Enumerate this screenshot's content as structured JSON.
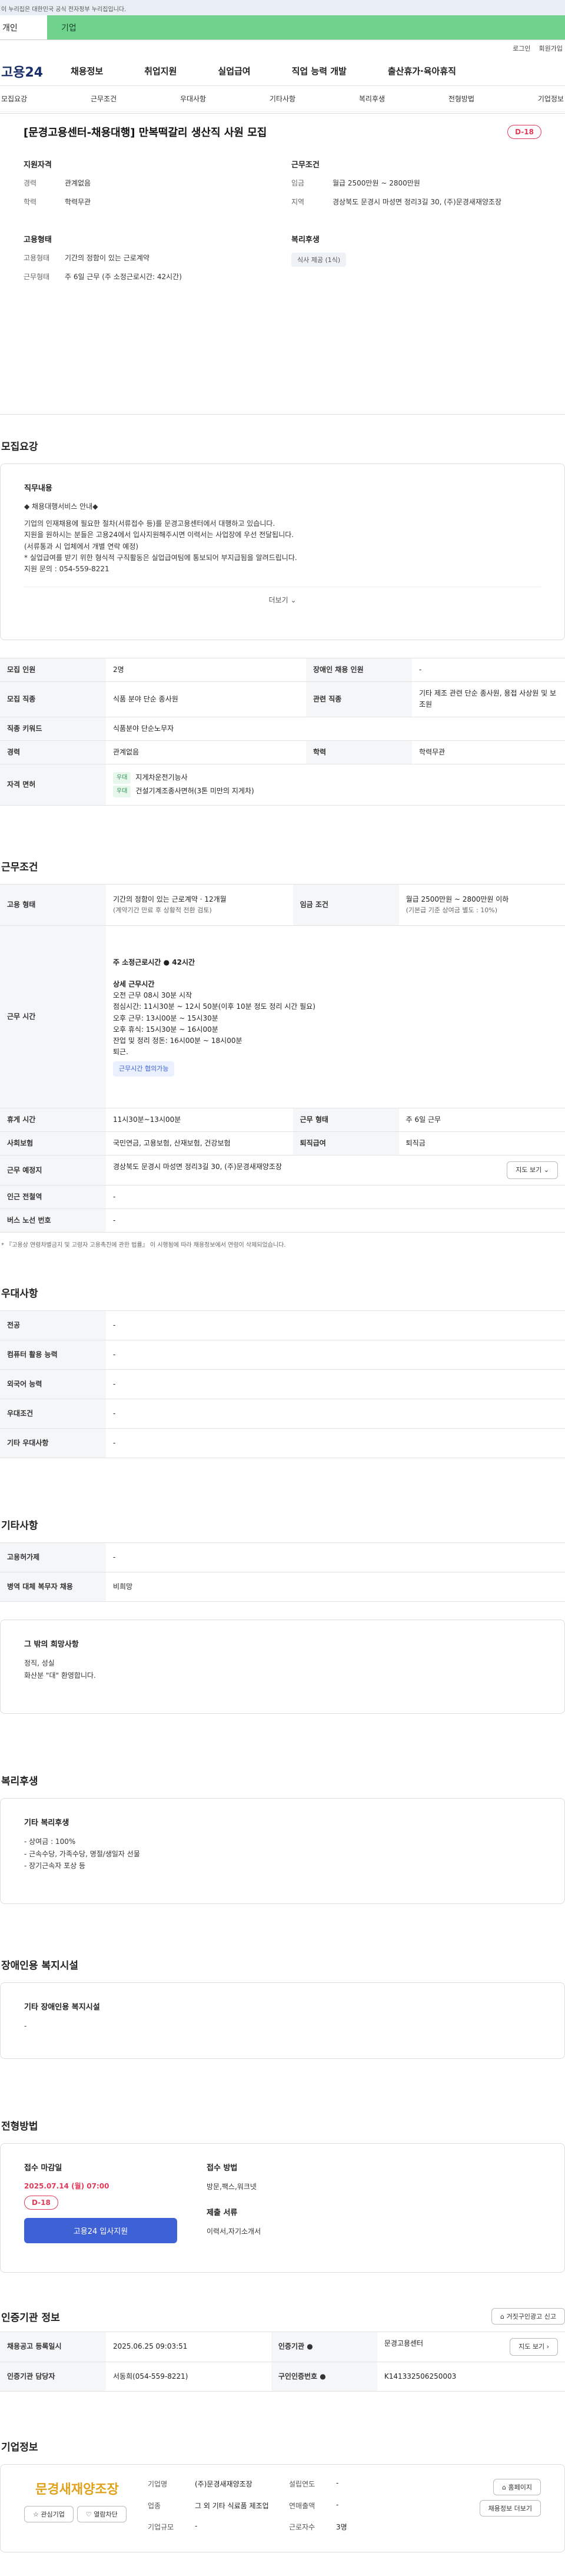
{
  "topbar": {
    "notice": "이 누리집은 대한민국 공식 전자정부 누리집입니다."
  },
  "tabs": {
    "personal": "개인",
    "company": "기업"
  },
  "util": {
    "login": "로그인",
    "join": "회원가입"
  },
  "gnb": {
    "logo": "고용24",
    "menu": [
      "채용정보",
      "취업지원",
      "실업급여",
      "직업 능력 개발",
      "출산휴가·육아휴직"
    ]
  },
  "anchors": [
    "모집요강",
    "근무조건",
    "우대사항",
    "기타사항",
    "복리후생",
    "전형방법",
    "기업정보"
  ],
  "job": {
    "title": "[문경고용센터-채용대행] 만복떡갈리 생산직 사원 모집",
    "dday": "D-18",
    "qual": {
      "h": "지원자격",
      "career_k": "경력",
      "career_v": "관계없음",
      "edu_k": "학력",
      "edu_v": "학력무관"
    },
    "cond": {
      "h": "근무조건",
      "wage_k": "임금",
      "wage_v": "월급 2500만원 ~ 2800만원",
      "region_k": "지역",
      "region_v": "경상북도 문경시 마성면 정리3길 30, (주)문경새재양조장"
    },
    "emp": {
      "h": "고용형태",
      "type_k": "고용형태",
      "type_v": "기간의 정함이 있는 근로계약",
      "time_k": "근무형태",
      "time_v": "주 6일 근무 (주 소정근로시간: 42시간)"
    },
    "welfare": {
      "h": "복리후생",
      "tag": "식사 제공 (1식)"
    }
  },
  "recruit": {
    "h": "모집요강",
    "desc_h": "직무내용",
    "desc": [
      "◆ 채용대행서비스 안내◆",
      "기업의 인재채용에 필요한 절차(서류접수 등)를 문경고용센터에서 대행하고 있습니다.",
      "지원을 원하시는 분들은 고용24에서 입사지원해주시면 이력서는 사업장에 우선 전달됩니다.",
      "(서류통과 시 업체에서 개별 연락 예정)",
      "* 실업급여를 받기 위한 형식적 구직활동은 실업급여팀에 통보되어 부지급됨을 알려드립니다.",
      "지원 문의 : 054-559-8221"
    ],
    "more": "더보기",
    "rows": {
      "count_k": "모집 인원",
      "count_v": "2명",
      "dis_k": "장애인 채용 인원",
      "dis_v": "-",
      "job_k": "모집 직종",
      "job_v": "식품 분야 단순 종사원",
      "rel_k": "관련 직종",
      "rel_v": "기타 제조 관련 단순 종사원, 용접 사상원 및 보조원",
      "kw_k": "직종 키워드",
      "kw_v": "식품분야 단순노무자",
      "career_k": "경력",
      "career_v": "관계없음",
      "edu_k": "학력",
      "edu_v": "학력무관",
      "lic_k": "자격 면허",
      "lic": [
        {
          "badge": "우대",
          "name": "지게차운전기능사"
        },
        {
          "badge": "우대",
          "name": "건설기계조종사면허(3톤 미만의 지게차)"
        }
      ]
    }
  },
  "work": {
    "h": "근무조건",
    "emp_k": "고용 형태",
    "emp_v": "기간의 정함이 있는 근로계약 · 12개월",
    "emp_sub": "(계약기간 만료 후 상황적 전환 검토)",
    "wage_k": "임금 조건",
    "wage_v": "월급 2500만원 ~ 2800만원 이하",
    "wage_sub": "(기본급 기준 상여금 별도 : 10%)",
    "time_k": "근무 시간",
    "time_lines": [
      "주 소정근로시간 ● 42시간",
      "",
      "상세 근무시간",
      "오전 근무 08시 30분 시작",
      "점심시간: 11시30분 ~ 12시 50분(이후 10분 정도 정리 시간 필요)",
      "오후 근무: 13시00분 ~ 15시30분",
      "오후 휴식: 15시30분 ~ 16시00분",
      "잔업 및 정리 정돈: 16시00분 ~ 18시00분",
      "퇴근."
    ],
    "time_tag": "근무시간 협의가능",
    "rest_k": "휴게 시간",
    "rest_v": "11시30분~13시00분",
    "form_k": "근무 형태",
    "form_v": "주 6일 근무",
    "ins_k": "사회보험",
    "ins_v": "국민연금, 고용보험, 산재보험, 건강보험",
    "ret_k": "퇴직급여",
    "ret_v": "퇴직금",
    "loc_k": "근무 예정지",
    "loc_v": "경상북도 문경시 마성면 정리3길 30, (주)문경새재양조장",
    "map": "지도 보기",
    "sub_k": "인근 전철역",
    "sub_v": "-",
    "bus_k": "버스 노선 번호",
    "bus_v": "-",
    "note": "* 『고용상 연령차별금지 및 고령자 고용촉진에 관한 법률』 이 시행됨에 따라 채용정보에서 연령이 삭제되었습니다."
  },
  "pref": {
    "h": "우대사항",
    "rows": [
      [
        "전공",
        "-"
      ],
      [
        "컴퓨터 활용 능력",
        "-"
      ],
      [
        "외국어 능력",
        "-"
      ],
      [
        "우대조건",
        "-"
      ],
      [
        "기타 우대사항",
        "-"
      ]
    ]
  },
  "etc": {
    "h": "기타사항",
    "rows": [
      [
        "고용허가제",
        "-"
      ],
      [
        "병역 대체 복무자 채용",
        "비희망"
      ]
    ],
    "box_h": "그 밖의 희망사항",
    "box": [
      "정직, 성실",
      "화산분 \"대\" 환영합니다."
    ]
  },
  "benefit": {
    "h": "복리후생",
    "box_h": "기타 복리후생",
    "box": [
      "- 상여금 : 100%",
      "- 근속수당, 가족수당, 명절/생일자 선물",
      "- 장기근속자 포상 등"
    ]
  },
  "disfac": {
    "h": "장애인용 복지시설",
    "box_h": "기타 장애인용 복지시설",
    "box": [
      "-"
    ]
  },
  "process": {
    "h": "전형방법",
    "deadline_h": "접수 마감일",
    "deadline": "2025.07.14 (월) 07:00",
    "dday": "D-18",
    "apply": "고용24 입사지원",
    "method_h": "접수 방법",
    "method": "방문,팩스,워크넷",
    "docs_h": "제출 서류",
    "docs": "이력서,자기소개서"
  },
  "cert": {
    "h": "인증기관 정보",
    "report": "거짓구인광고 신고",
    "rows": {
      "reg_k": "채용공고 등록일시",
      "reg_v": "2025.06.25 09:03:51",
      "org_k": "인증기관 ●",
      "org_v": "문경고용센터",
      "map": "지도 보기",
      "mgr_k": "인증기관 담당자",
      "mgr_v": "서동희(054-559-8221)",
      "no_k": "구인인증번호 ●",
      "no_v": "K141332506250003"
    }
  },
  "company": {
    "h": "기업정보",
    "logo": "문경새재양조장",
    "fav": "관심기업",
    "block": "열람차단",
    "name_k": "기업명",
    "name_v": "(주)문경새재양조장",
    "est_k": "설립연도",
    "est_v": "-",
    "ind_k": "업종",
    "ind_v": "그 외 기타 식료품 제조업",
    "sales_k": "연매출액",
    "sales_v": "-",
    "emp_k": "근로자수",
    "emp_v": "3명",
    "size_k": "기업규모",
    "size_v": "-",
    "home": "홈페이지",
    "more": "채용정보 더보기"
  }
}
